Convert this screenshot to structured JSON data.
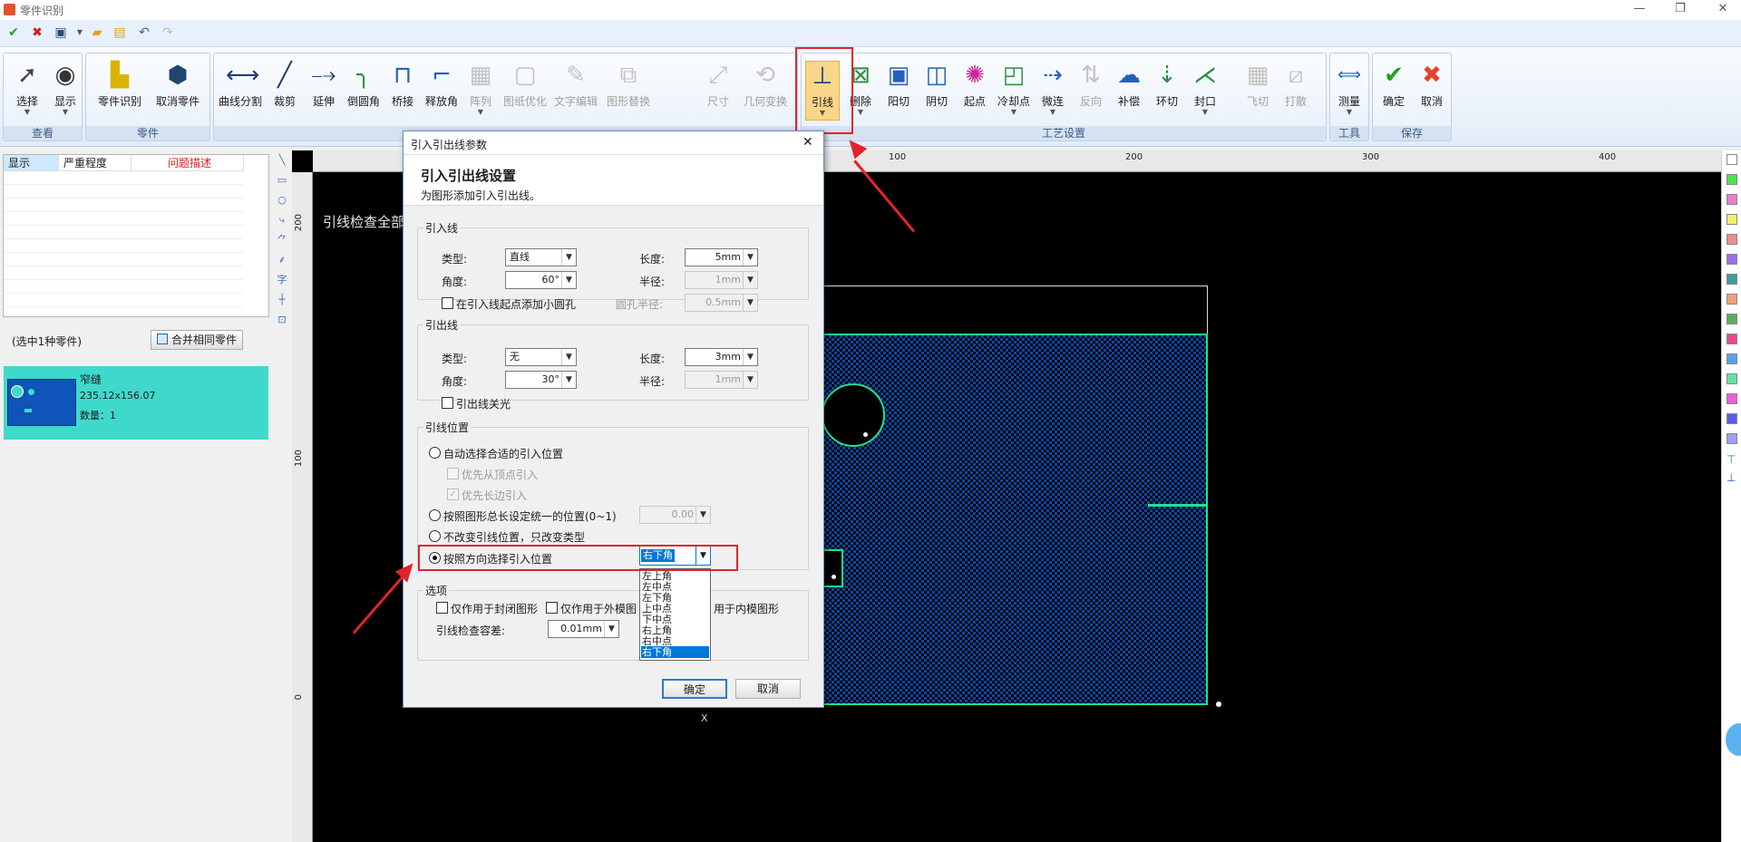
{
  "titlebar": {
    "title": "零件识别"
  },
  "ribbon": {
    "groups": [
      {
        "label": "查看",
        "buttons": [
          "选择",
          "显示"
        ]
      },
      {
        "label": "零件",
        "buttons": [
          "零件识别",
          "取消零件"
        ]
      },
      {
        "label": "",
        "buttons": [
          "曲线分割",
          "裁剪",
          "延伸",
          "倒圆角",
          "桥接",
          "释放角",
          "阵列",
          "图纸优化",
          "文字编辑",
          "图形替换",
          "尺寸",
          "几何变换"
        ]
      },
      {
        "label": "工艺设置",
        "buttons": [
          "引线",
          "删除",
          "阳切",
          "阴切",
          "起点",
          "冷却点",
          "微连",
          "反向",
          "补偿",
          "环切",
          "封口",
          "飞切",
          "打散"
        ]
      },
      {
        "label": "工具",
        "buttons": [
          "测量"
        ]
      },
      {
        "label": "保存",
        "buttons": [
          "确定",
          "取消"
        ]
      }
    ]
  },
  "issues": {
    "headers": [
      "显示",
      "严重程度",
      "问题描述"
    ]
  },
  "parts": {
    "selected_count": "(选中1种零件)",
    "merge_button": "合并相同零件",
    "card": {
      "name": "窄缝",
      "size": "235.12x156.07",
      "quantity": "数量：1"
    }
  },
  "canvas": {
    "check_text": "引线检查全部",
    "hruler": [
      "100",
      "200",
      "300",
      "400"
    ],
    "vruler": [
      "200",
      "100",
      "0"
    ],
    "x_label": "X",
    "colors": {
      "part_outline": "#19e68c",
      "part_fill": "#0d47a1",
      "background": "#000000"
    }
  },
  "dialog": {
    "title": "引入引出线参数",
    "heading": "引入引出线设置",
    "subheading": "为图形添加引入引出线。",
    "lead_in": {
      "legend": "引入线",
      "type_label": "类型:",
      "type_value": "直线",
      "length_label": "长度:",
      "length_value": "5mm",
      "angle_label": "角度:",
      "angle_value": "60°",
      "radius_label": "半径:",
      "radius_value": "1mm",
      "small_circle_label": "在引入线起点添加小圆孔",
      "hole_radius_label": "圆孔半径:",
      "hole_radius_value": "0.5mm"
    },
    "lead_out": {
      "legend": "引出线",
      "type_label": "类型:",
      "type_value": "无",
      "length_label": "长度:",
      "length_value": "3mm",
      "angle_label": "角度:",
      "angle_value": "30°",
      "radius_label": "半径:",
      "radius_value": "1mm",
      "laser_off_label": "引出线关光"
    },
    "position": {
      "legend": "引线位置",
      "auto_label": "自动选择合适的引入位置",
      "vertex_label": "优先从顶点引入",
      "long_edge_label": "优先长边引入",
      "uniform_label": "按照图形总长设定统一的位置(0~1)",
      "uniform_value": "0.00",
      "keep_label": "不改变引线位置，只改变类型",
      "direction_label": "按照方向选择引入位置",
      "direction_value": "右下角",
      "direction_options": [
        "左上角",
        "左中点",
        "左下角",
        "上中点",
        "下中点",
        "右上角",
        "右中点",
        "右下角"
      ]
    },
    "options": {
      "legend": "选项",
      "closed_label": "仅作用于封闭图形",
      "outer_label": "仅作用于外模图",
      "inner_label": "用于内模图形",
      "tolerance_label": "引线检查容差:",
      "tolerance_value": "0.01mm"
    },
    "ok": "确定",
    "cancel": "取消"
  }
}
